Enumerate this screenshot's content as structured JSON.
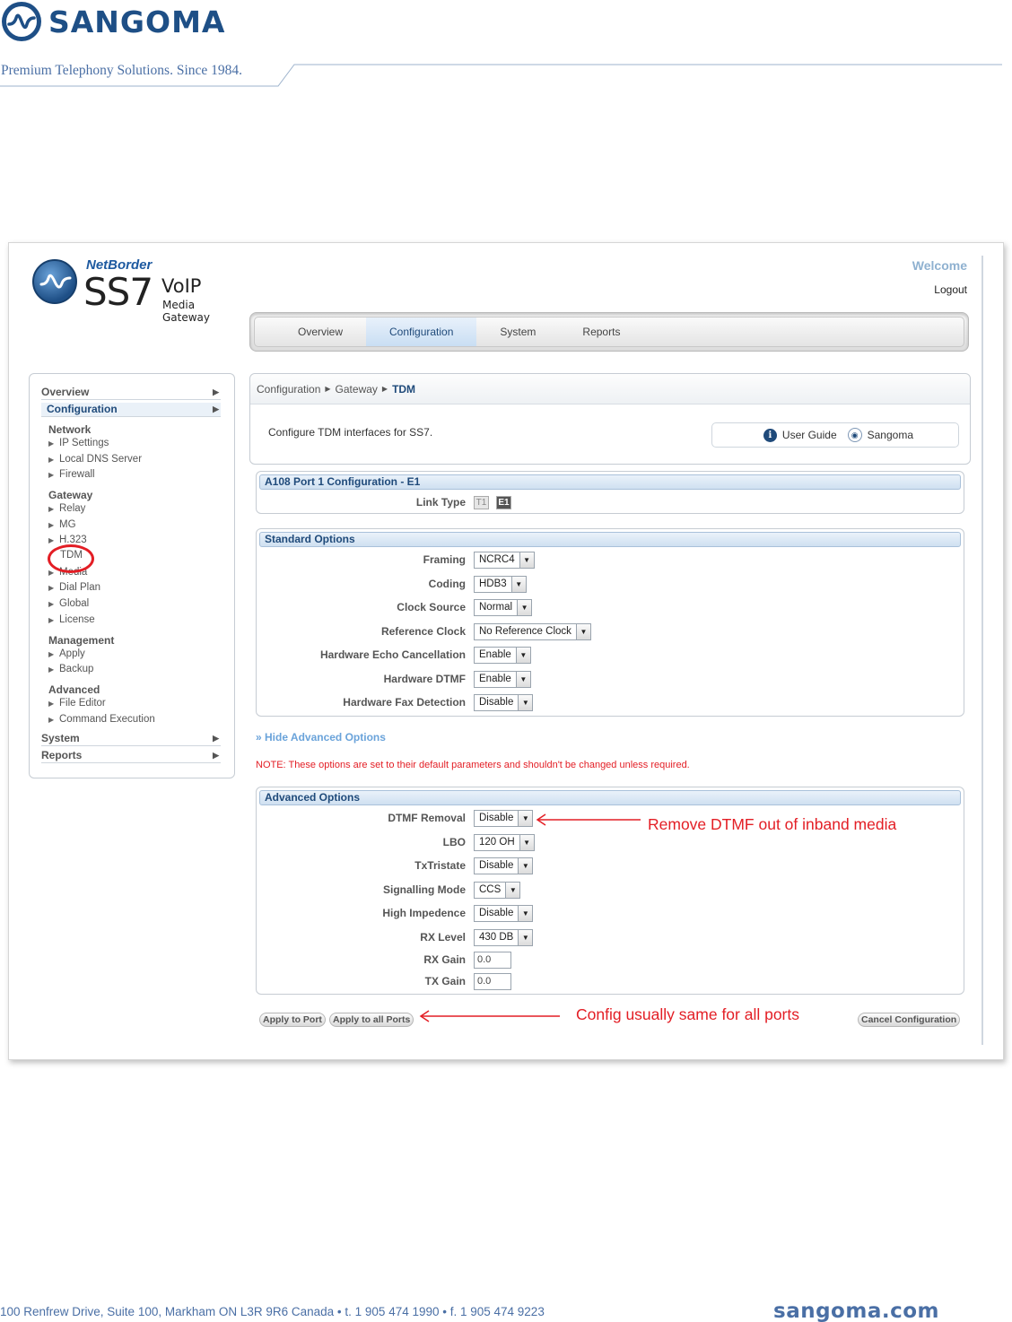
{
  "doc": {
    "company": "SANGOMA",
    "tagline": "Premium Telephony Solutions. Since 1984.",
    "footer_address": "100 Renfrew Drive, Suite 100, Markham ON L3R 9R6 Canada  •  t. 1 905 474 1990  •  f. 1 905 474 9223",
    "footer_site": "sangoma.com"
  },
  "app": {
    "brand": "NetBorder",
    "product": "SS7",
    "product_sub": "VoIP",
    "product_sub2": "Media Gateway",
    "welcome": "Welcome",
    "logout": "Logout"
  },
  "tabs": [
    "Overview",
    "Configuration",
    "System",
    "Reports"
  ],
  "sidebar": {
    "overview": "Overview",
    "configuration": "Configuration",
    "network": "Network",
    "network_items": [
      "IP Settings",
      "Local DNS Server",
      "Firewall"
    ],
    "gateway": "Gateway",
    "gateway_items": [
      "Relay",
      "MG",
      "H.323",
      "TDM",
      "Media",
      "Dial Plan",
      "Global",
      "License"
    ],
    "management": "Management",
    "management_items": [
      "Apply",
      "Backup"
    ],
    "advanced": "Advanced",
    "advanced_items": [
      "File Editor",
      "Command Execution"
    ],
    "system": "System",
    "reports": "Reports"
  },
  "breadcrumb": [
    "Configuration",
    "Gateway",
    "TDM"
  ],
  "description": "Configure TDM interfaces for SS7.",
  "guide": {
    "user_guide": "User Guide",
    "sangoma": "Sangoma"
  },
  "port_panel": {
    "title": "A108 Port 1 Configuration - E1",
    "link_type_label": "Link Type",
    "t1": "T1",
    "e1": "E1"
  },
  "standard": {
    "title": "Standard Options",
    "rows": [
      {
        "label": "Framing",
        "value": "NCRC4"
      },
      {
        "label": "Coding",
        "value": "HDB3"
      },
      {
        "label": "Clock Source",
        "value": "Normal"
      },
      {
        "label": "Reference Clock",
        "value": "No Reference Clock"
      },
      {
        "label": "Hardware Echo Cancellation",
        "value": "Enable"
      },
      {
        "label": "Hardware DTMF",
        "value": "Enable"
      },
      {
        "label": "Hardware Fax Detection",
        "value": "Disable"
      }
    ]
  },
  "hide_advanced": "» Hide Advanced Options",
  "note": "NOTE: These options are set to their default parameters and shouldn't be changed unless required.",
  "advanced": {
    "title": "Advanced Options",
    "rows": [
      {
        "label": "DTMF Removal",
        "value": "Disable"
      },
      {
        "label": "LBO",
        "value": "120 OH"
      },
      {
        "label": "TxTristate",
        "value": "Disable"
      },
      {
        "label": "Signalling Mode",
        "value": "CCS"
      },
      {
        "label": "High Impedence",
        "value": "Disable"
      },
      {
        "label": "RX Level",
        "value": "430 DB"
      }
    ],
    "rx_gain_label": "RX Gain",
    "rx_gain": "0.0",
    "tx_gain_label": "TX Gain",
    "tx_gain": "0.0"
  },
  "buttons": {
    "apply_port": "Apply to Port",
    "apply_all": "Apply to all Ports",
    "cancel": "Cancel Configuration"
  },
  "annotations": {
    "dtmf": "Remove DTMF out of inband media",
    "config": "Config usually same for all ports"
  },
  "colors": {
    "brand_blue": "#1e4f86",
    "annotation_red": "#e31e25"
  }
}
